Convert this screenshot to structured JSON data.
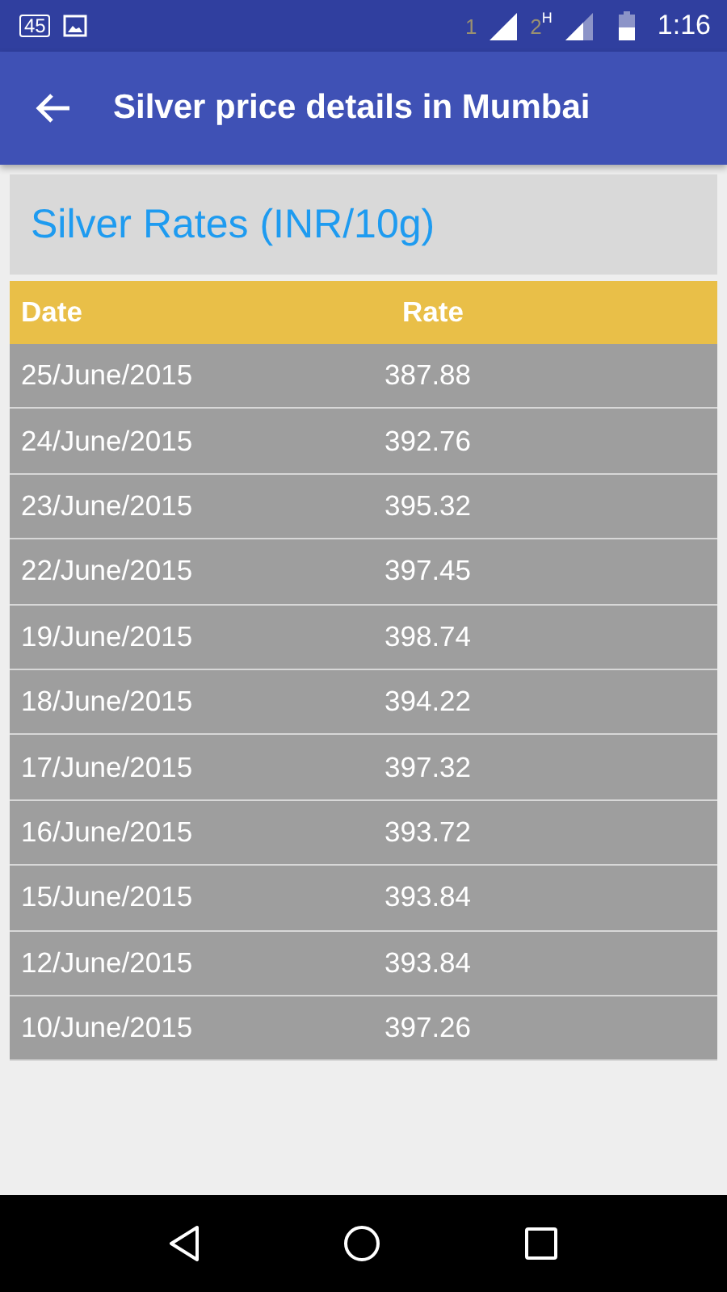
{
  "status_bar": {
    "notification_badge": "45",
    "sim_1": "1",
    "sim_2": "2",
    "network_type": "H",
    "time": "1:16"
  },
  "app_bar": {
    "title": "Silver price details in Mumbai"
  },
  "card": {
    "title": "Silver Rates (INR/10g)"
  },
  "table": {
    "columns": [
      "Date",
      "Rate"
    ],
    "rows": [
      {
        "date": "25/June/2015",
        "rate": "387.88"
      },
      {
        "date": "24/June/2015",
        "rate": "392.76"
      },
      {
        "date": "23/June/2015",
        "rate": "395.32"
      },
      {
        "date": "22/June/2015",
        "rate": "397.45"
      },
      {
        "date": "19/June/2015",
        "rate": "398.74"
      },
      {
        "date": "18/June/2015",
        "rate": "394.22"
      },
      {
        "date": "17/June/2015",
        "rate": "397.32"
      },
      {
        "date": "16/June/2015",
        "rate": "393.72"
      },
      {
        "date": "15/June/2015",
        "rate": "393.84"
      },
      {
        "date": "12/June/2015",
        "rate": "393.84"
      },
      {
        "date": "10/June/2015",
        "rate": "397.26"
      }
    ]
  }
}
